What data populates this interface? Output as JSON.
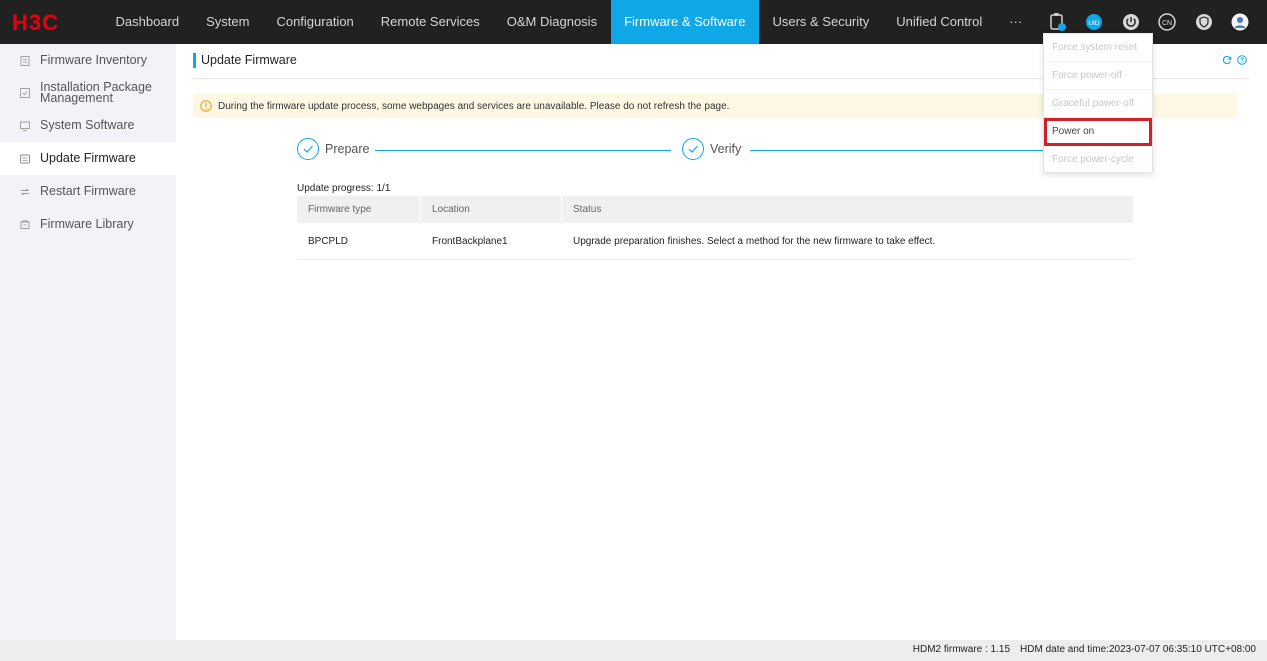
{
  "brand": {
    "logo_text": "H3C",
    "color": "#e60012"
  },
  "colors": {
    "accent": "#0fa7e6",
    "highlight_box": "#d0202a",
    "topbar": "#212121"
  },
  "nav": {
    "items": [
      {
        "label": "Dashboard"
      },
      {
        "label": "System"
      },
      {
        "label": "Configuration"
      },
      {
        "label": "Remote Services"
      },
      {
        "label": "O&M Diagnosis"
      },
      {
        "label": "Firmware & Software",
        "active": true
      },
      {
        "label": "Users & Security"
      },
      {
        "label": "Unified Control"
      },
      {
        "label": "···"
      }
    ]
  },
  "top_icons": {
    "clipboard": "clipboard-icon",
    "uid_badge": "UID",
    "power": "power-icon",
    "language": "CN",
    "shield": "shield-icon",
    "user": "user-avatar-icon"
  },
  "sidebar": {
    "items": [
      {
        "label": "Firmware Inventory",
        "icon": "list-icon"
      },
      {
        "label": "Installation Package Management",
        "icon": "package-icon"
      },
      {
        "label": "System Software",
        "icon": "monitor-icon"
      },
      {
        "label": "Update Firmware",
        "icon": "update-icon",
        "active": true
      },
      {
        "label": "Restart Firmware",
        "icon": "restart-icon"
      },
      {
        "label": "Firmware Library",
        "icon": "library-icon"
      }
    ]
  },
  "main": {
    "title": "Update Firmware",
    "notice": "During the firmware update process, some webpages and services are unavailable. Please do not refresh the page.",
    "steps": [
      {
        "label": "Prepare",
        "done": true
      },
      {
        "label": "Verify",
        "done": true
      }
    ],
    "progress_text": "Update progress: 1/1",
    "table": {
      "headers": [
        "Firmware type",
        "Location",
        "Status"
      ],
      "rows": [
        [
          "BPCPLD",
          "FrontBackplane1",
          "Upgrade preparation finishes. Select a method for the new firmware to take effect."
        ]
      ]
    }
  },
  "power_menu": {
    "items": [
      {
        "label": "Force system reset",
        "enabled": false
      },
      {
        "label": "Force power-off",
        "enabled": false
      },
      {
        "label": "Graceful power-off",
        "enabled": false
      },
      {
        "label": "Power on",
        "enabled": true,
        "highlighted": true
      },
      {
        "label": "Force power-cycle",
        "enabled": false
      }
    ]
  },
  "footer": {
    "firmware": "HDM2 firmware : 1.15",
    "datetime": "HDM date and time:2023-07-07 06:35:10 UTC+08:00"
  }
}
